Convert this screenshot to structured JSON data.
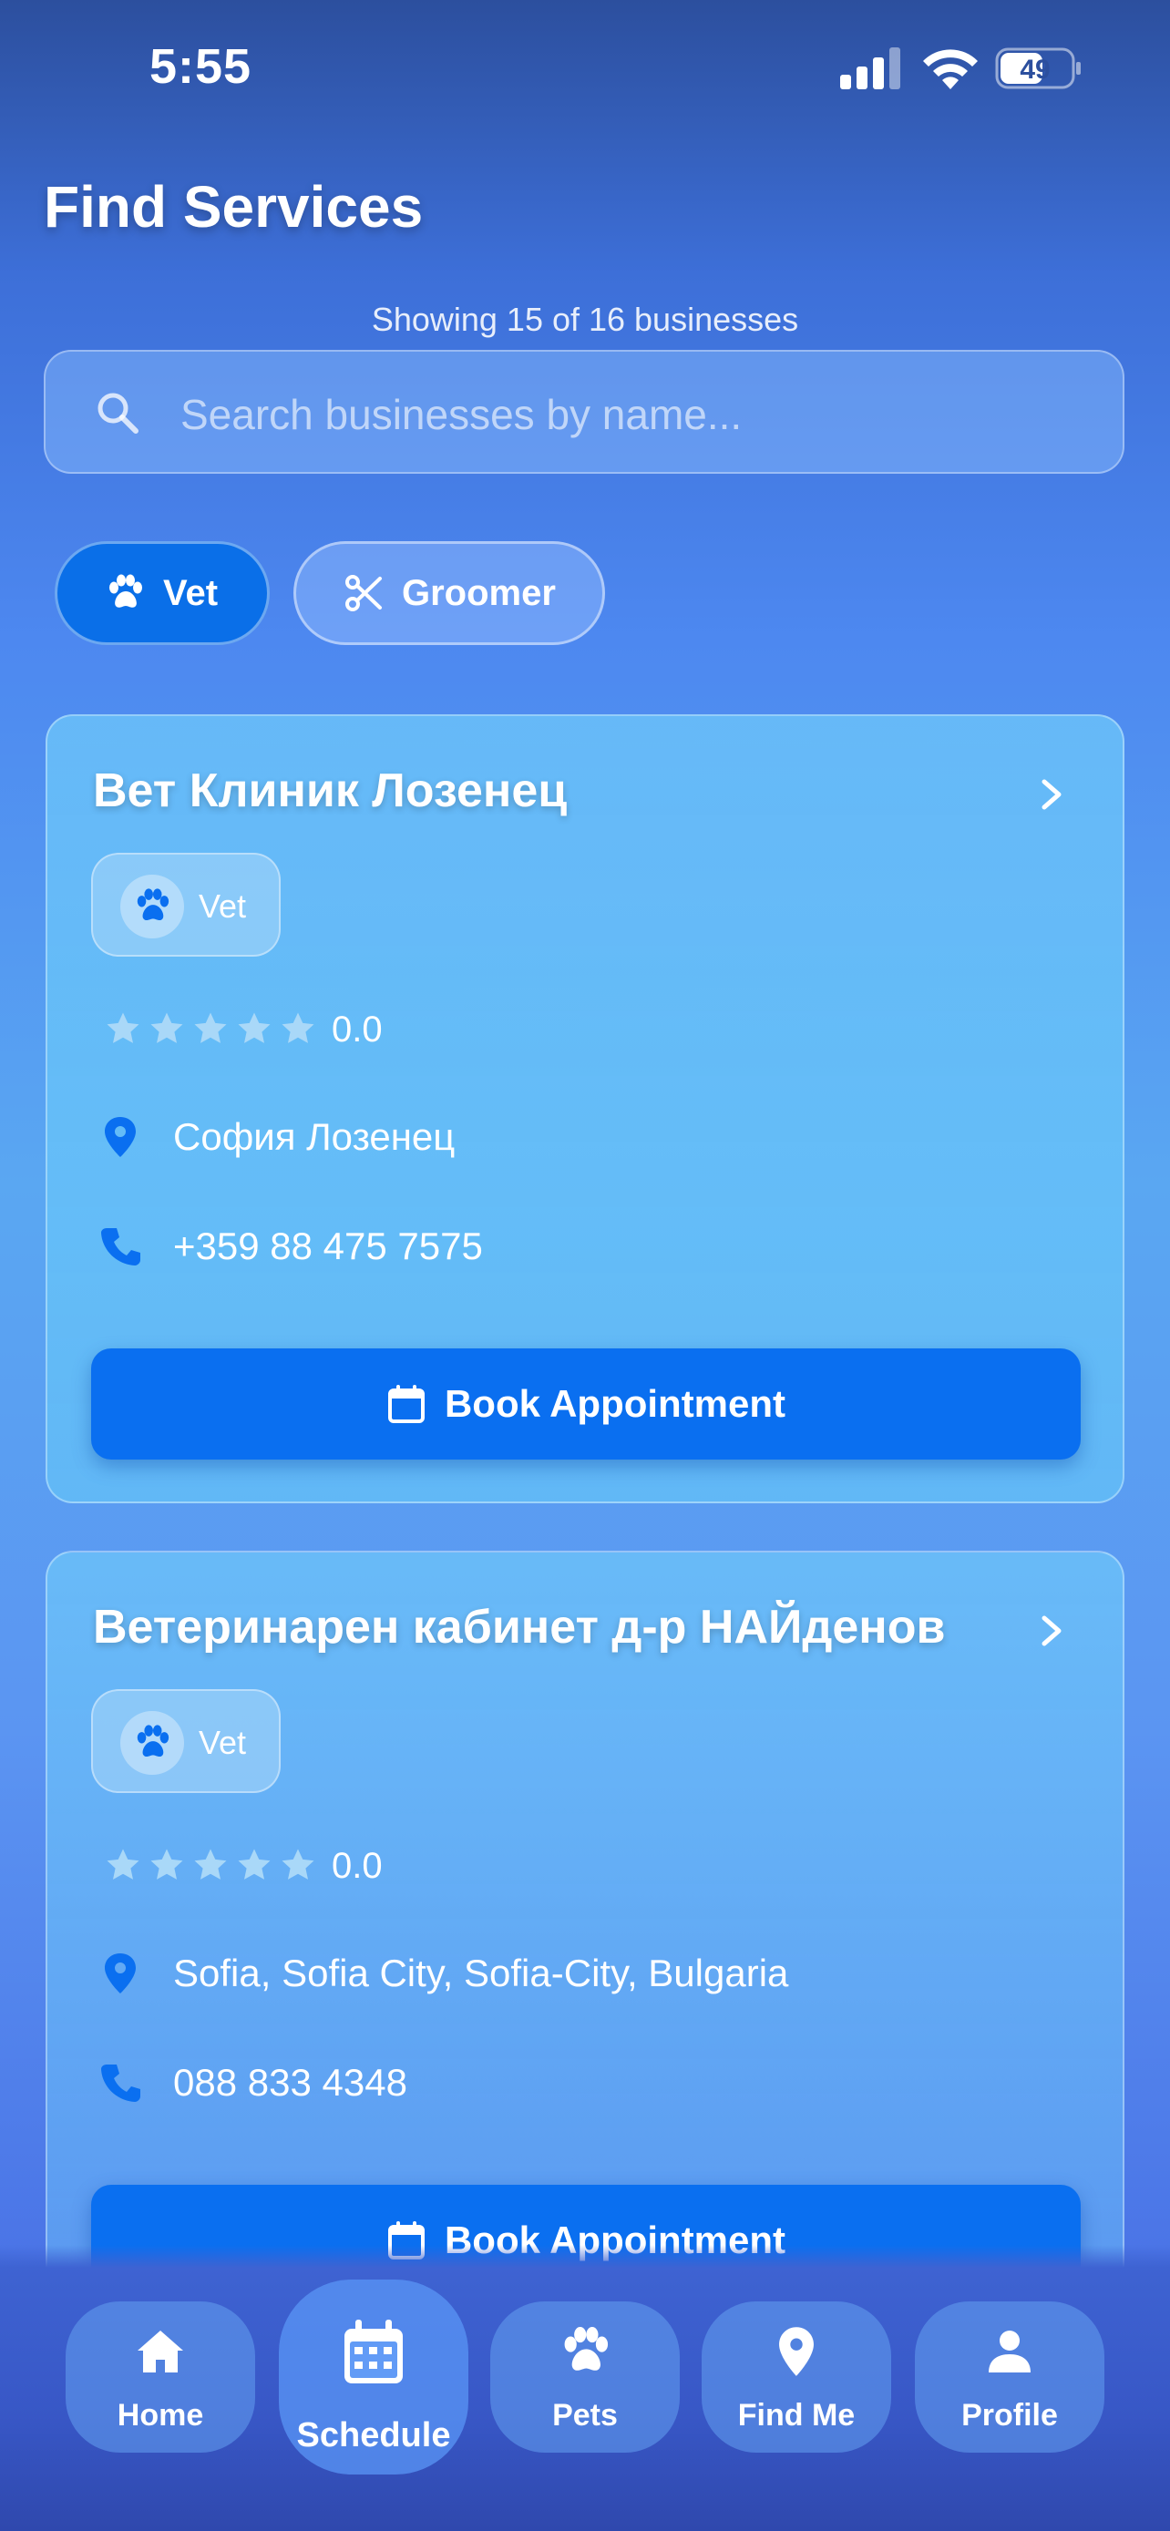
{
  "status_bar": {
    "time": "5:55",
    "battery_level": "49"
  },
  "page": {
    "title": "Find Services",
    "results_count": "Showing 15 of 16 businesses"
  },
  "search": {
    "placeholder": "Search businesses by name...",
    "value": ""
  },
  "filters": [
    {
      "label": "Vet",
      "icon": "paw-icon",
      "selected": true
    },
    {
      "label": "Groomer",
      "icon": "scissors-icon",
      "selected": false
    }
  ],
  "businesses": [
    {
      "name": "Вет Клиник Лозенец",
      "category": "Vet",
      "rating": "0.0",
      "location": "София Лозенец",
      "phone": "+359 88 475 7575",
      "book_label": "Book Appointment"
    },
    {
      "name": "Ветеринарен кабинет д-р НАЙденов",
      "category": "Vet",
      "rating": "0.0",
      "location": "Sofia, Sofia City, Sofia-City, Bulgaria",
      "phone": "088 833 4348",
      "book_label": "Book Appointment"
    }
  ],
  "nav": [
    {
      "label": "Home",
      "icon": "home-icon"
    },
    {
      "label": "Schedule",
      "icon": "calendar-icon",
      "active": true
    },
    {
      "label": "Pets",
      "icon": "paw-icon"
    },
    {
      "label": "Find Me",
      "icon": "location-pin-icon"
    },
    {
      "label": "Profile",
      "icon": "person-icon"
    }
  ],
  "colors": {
    "accent": "#0a6ff0",
    "star_empty": "#a9d8f8",
    "icon_blue": "#0a6ff0"
  }
}
